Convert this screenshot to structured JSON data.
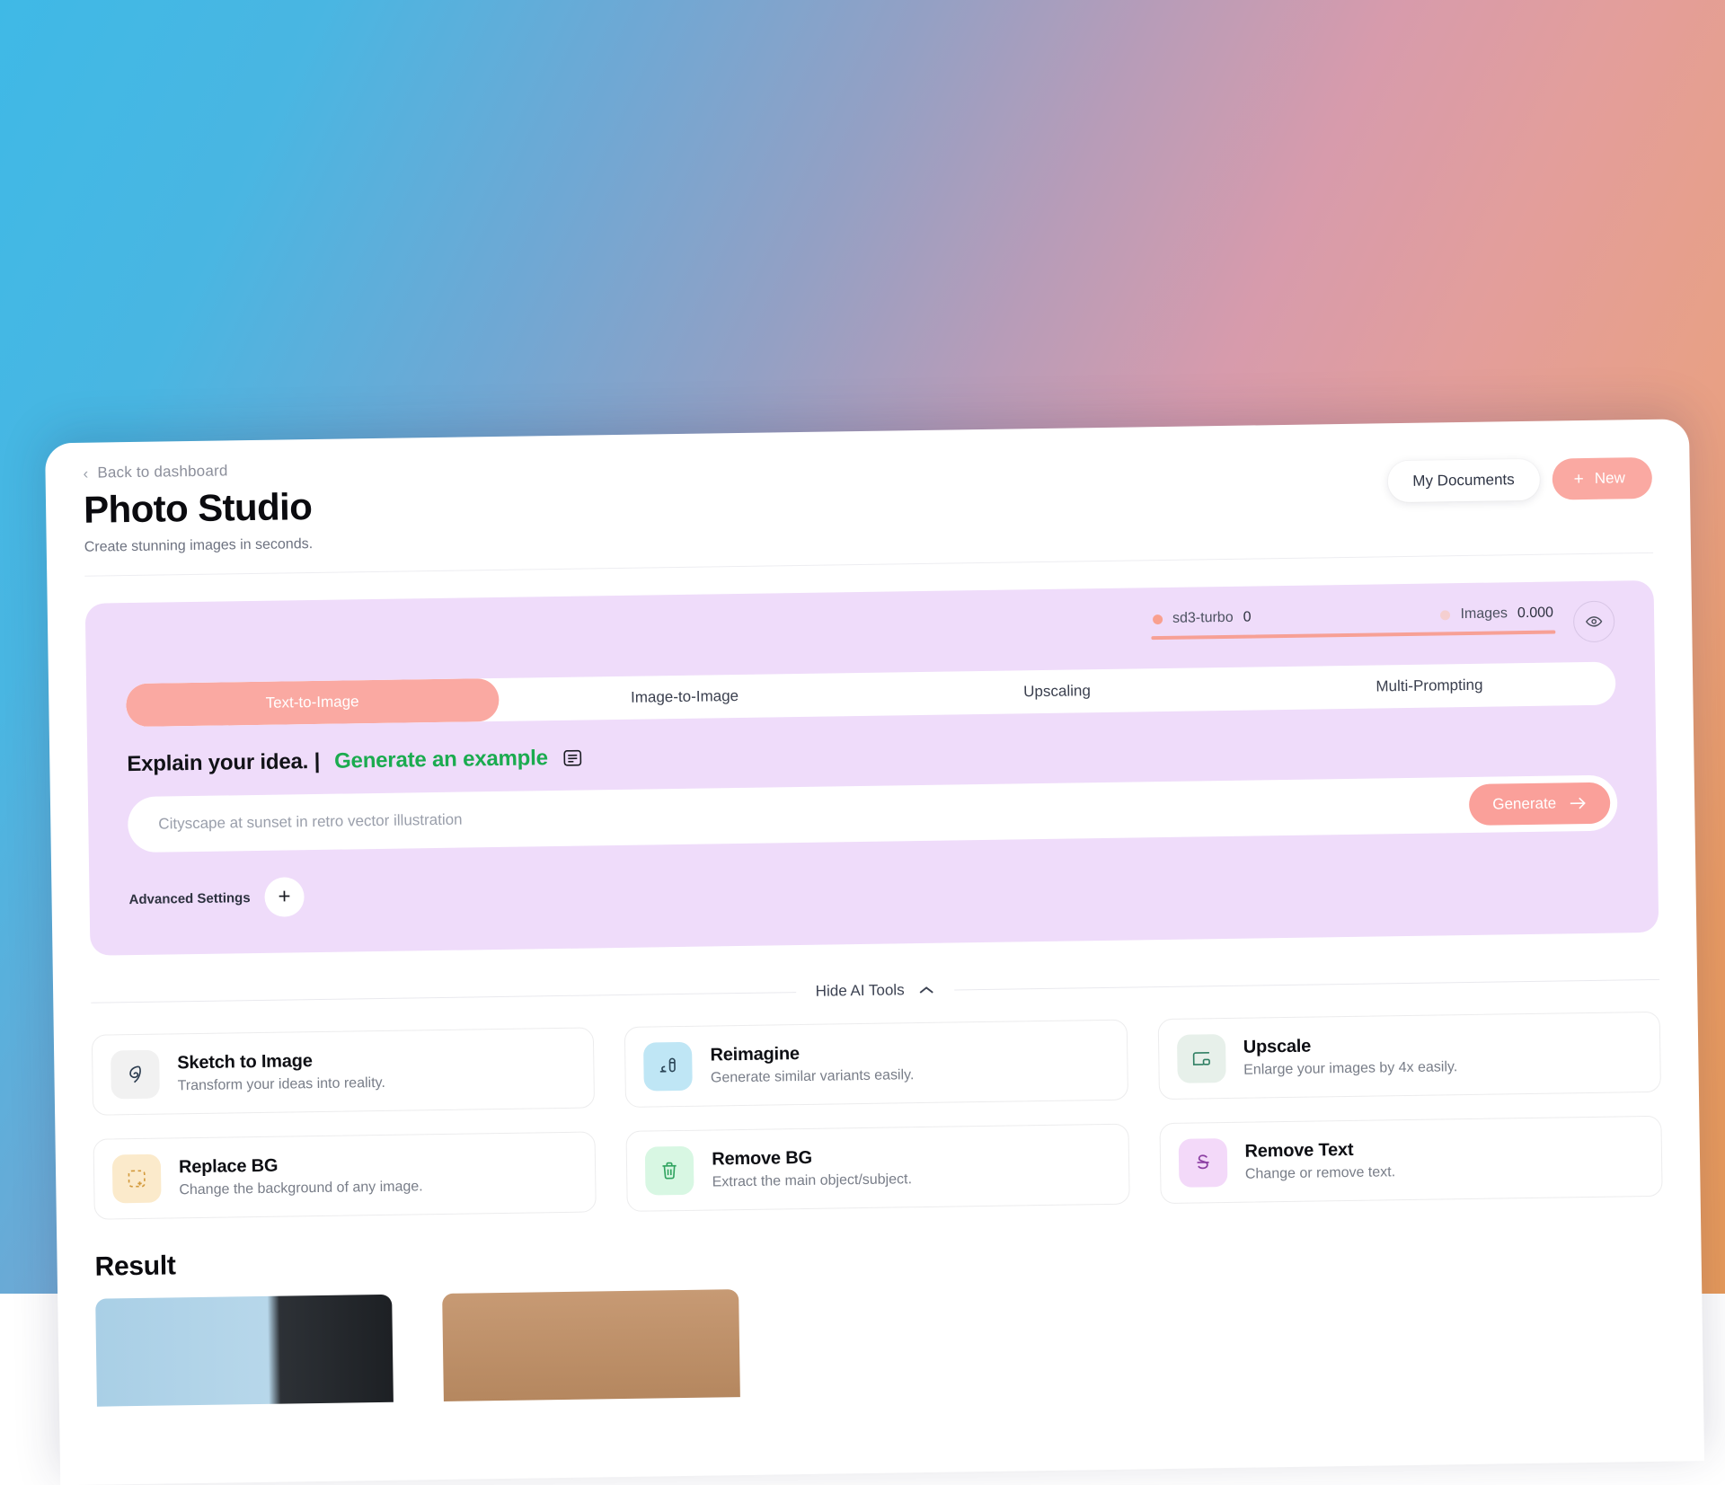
{
  "background": {
    "gradient_colors": [
      "#3fb9e6",
      "#94a0c4",
      "#d79bac",
      "#e79a5a"
    ]
  },
  "header": {
    "back_link": "Back to dashboard",
    "back_icon": "chevron-left-icon",
    "title": "Photo Studio",
    "subtitle": "Create stunning images in seconds.",
    "my_documents_label": "My Documents",
    "new_label": "New",
    "new_icon": "plus-icon",
    "accent_color": "#faa9a2"
  },
  "generator": {
    "panel_color": "#efdcfa",
    "stats": [
      {
        "name": "sd3-turbo",
        "value": "0",
        "dot_color": "#f9a08f"
      },
      {
        "name": "Images",
        "value": "0.000",
        "dot_color": "#f5cfd0"
      }
    ],
    "meter_color": "#f7a095",
    "preview_icon": "eye-icon",
    "tabs": [
      {
        "label": "Text-to-Image",
        "active": true
      },
      {
        "label": "Image-to-Image",
        "active": false
      },
      {
        "label": "Upscaling",
        "active": false
      },
      {
        "label": "Multi-Prompting",
        "active": false
      }
    ],
    "prompt_heading": "Explain your idea. |",
    "generate_example_link": "Generate an example",
    "generate_example_color": "#1bab4f",
    "list_icon": "list-box-icon",
    "prompt_placeholder": "Cityscape at sunset in retro vector illustration",
    "prompt_value": "",
    "generate_label": "Generate",
    "generate_arrow_icon": "arrow-right-icon",
    "advanced_label": "Advanced Settings",
    "advanced_toggle": "+"
  },
  "tools_divider": {
    "label": "Hide AI Tools",
    "chevron_icon": "chevron-up-icon"
  },
  "tools": [
    {
      "title": "Sketch to Image",
      "desc": "Transform your ideas into reality.",
      "icon": "scribble-icon",
      "icon_bg": "#f1f1f1",
      "icon_color": "#2b3b4e"
    },
    {
      "title": "Reimagine",
      "desc": "Generate similar variants easily.",
      "icon": "magic-pen-icon",
      "icon_bg": "#bfe6f5",
      "icon_color": "#2b4657"
    },
    {
      "title": "Upscale",
      "desc": "Enlarge your images by 4x easily.",
      "icon": "expand-frame-icon",
      "icon_bg": "#e7f0ea",
      "icon_color": "#2f7f63"
    },
    {
      "title": "Replace BG",
      "desc": "Change the background of any image.",
      "icon": "dashed-square-plus-icon",
      "icon_bg": "#fbeacb",
      "icon_color": "#d39a3c"
    },
    {
      "title": "Remove BG",
      "desc": "Extract the main object/subject.",
      "icon": "trash-icon",
      "icon_bg": "#d8f7e3",
      "icon_color": "#2fa35f"
    },
    {
      "title": "Remove Text",
      "desc": "Change or remove text.",
      "icon": "strikethrough-s-icon",
      "icon_bg": "#f3d9f9",
      "icon_color": "#8c3fa3"
    }
  ],
  "result": {
    "title": "Result",
    "thumbnails": [
      "thumbnail-1",
      "thumbnail-2"
    ]
  }
}
